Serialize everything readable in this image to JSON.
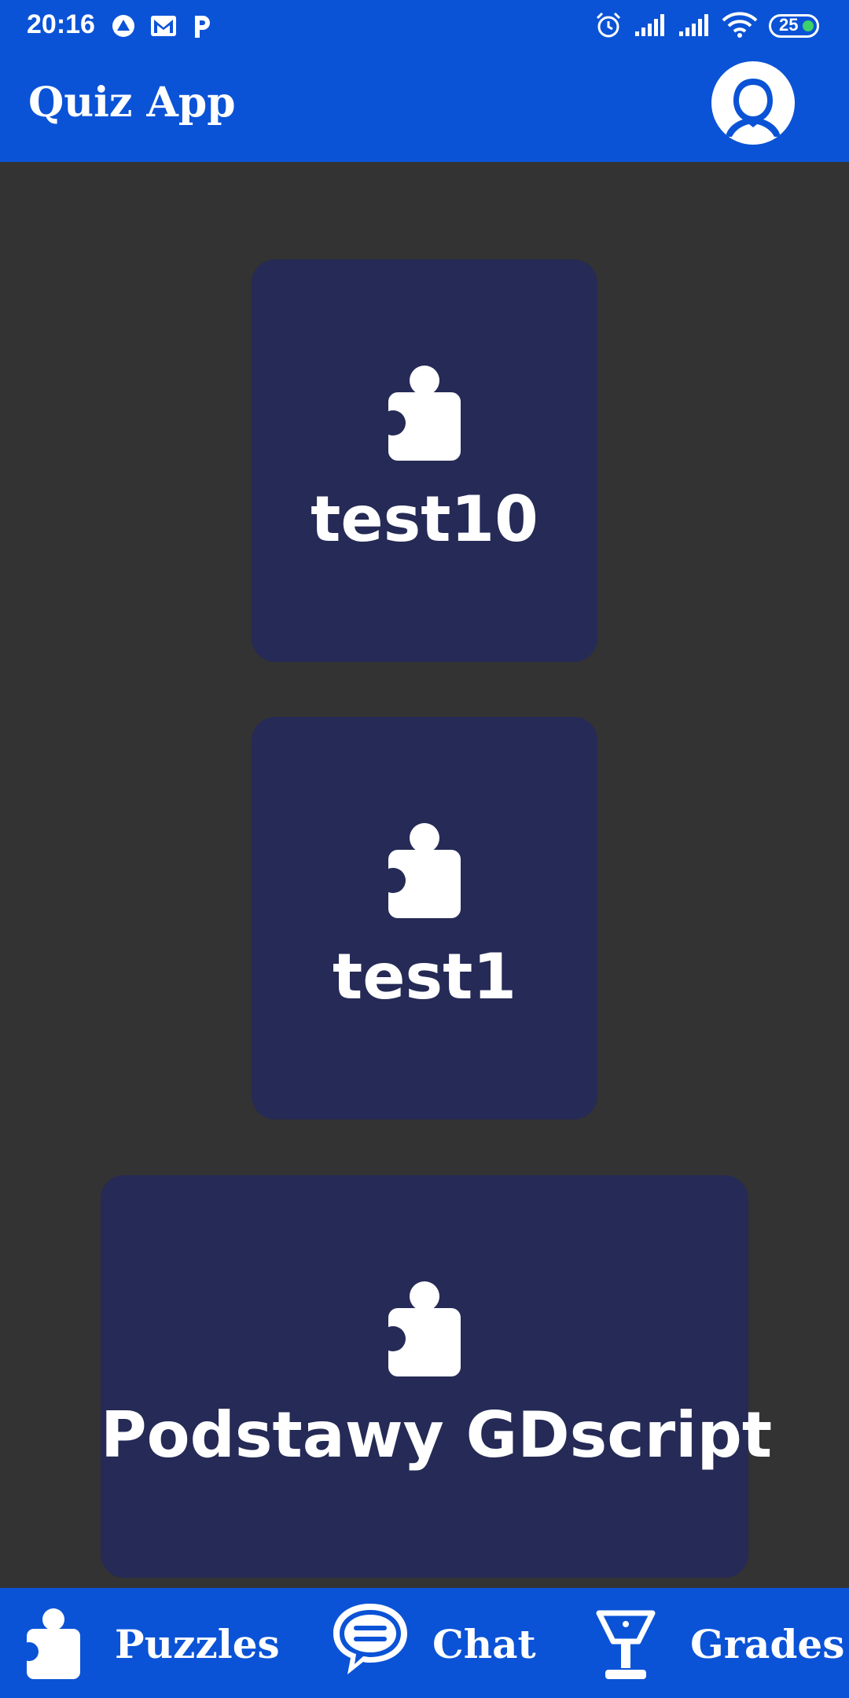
{
  "status_bar": {
    "time": "20:16",
    "battery": "25"
  },
  "app_bar": {
    "title": "Quiz App"
  },
  "cards": [
    {
      "label": "test10"
    },
    {
      "label": "test1"
    },
    {
      "label": "Podstawy GDscript"
    }
  ],
  "bottom_nav": {
    "puzzles": "Puzzles",
    "chat": "Chat",
    "grades": "Grades"
  },
  "colors": {
    "primary": "#0b53d6",
    "background": "#333333",
    "card": "#252a56",
    "battery_dot": "#3cd16b"
  }
}
